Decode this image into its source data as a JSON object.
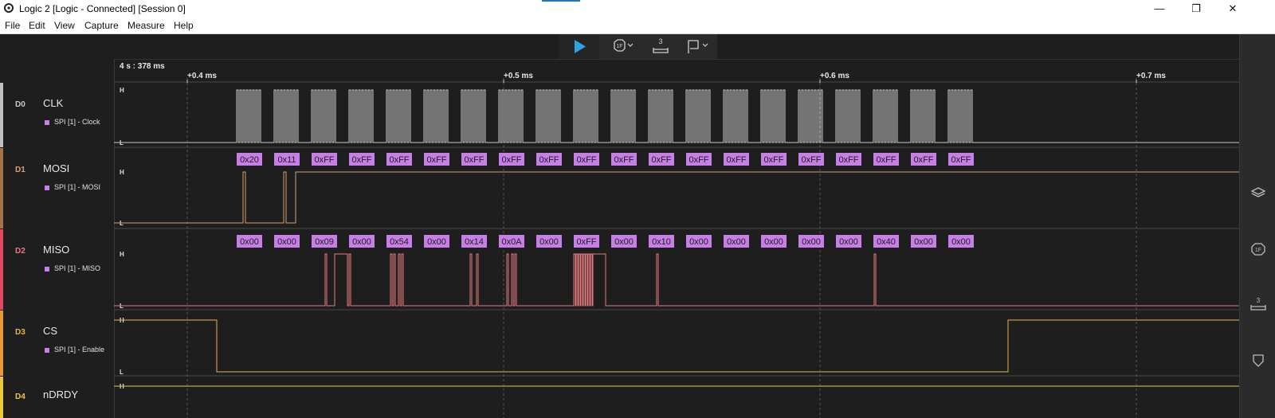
{
  "window": {
    "title": "Logic 2 [Logic - Connected] [Session 0]",
    "controls": {
      "minimize": "—",
      "maximize": "❐",
      "close": "✕"
    }
  },
  "menu": [
    "File",
    "Edit",
    "View",
    "Capture",
    "Measure",
    "Help"
  ],
  "toolbar": {
    "play_icon": "play-icon",
    "analyzers_icon": "analyzer-hex-icon",
    "measure_icon": "measure-icon",
    "marker_icon": "flag-icon",
    "measure_badge": "3"
  },
  "rightbar": {
    "icons": [
      "layers-icon",
      "analyzer-hex-icon",
      "measure-icon",
      "marker-icon"
    ],
    "analyzer_badge": "1F",
    "measure_badge": "3"
  },
  "timeline": {
    "origin": "4 s : 378 ms",
    "ticks": [
      {
        "label": "+0.4 ms",
        "value": 0.4
      },
      {
        "label": "+0.5 ms",
        "value": 0.5
      },
      {
        "label": "+0.6 ms",
        "value": 0.6
      },
      {
        "label": "+0.7 ms",
        "value": 0.7
      }
    ],
    "range_ms": [
      0.377,
      0.734
    ]
  },
  "colors": {
    "analyzer_label": "#c77ee6",
    "clk": "#cfcfcf",
    "mosi": "#d9a070",
    "miso": "#e87a80",
    "cs": "#e8b14a",
    "ndrdy": "#e8c843",
    "accent": "#2ea3df"
  },
  "channels": [
    {
      "index": "D0",
      "name": "CLK",
      "analyzer": "SPI [1] - Clock",
      "color": "#c9c9c9",
      "strip": "#c0c0c0",
      "high": "H",
      "low": "L"
    },
    {
      "index": "D1",
      "name": "MOSI",
      "analyzer": "SPI [1] - MOSI",
      "color": "#d9a070",
      "strip": "#a5734a",
      "high": "H",
      "low": "L"
    },
    {
      "index": "D2",
      "name": "MISO",
      "analyzer": "SPI [1] - MISO",
      "color": "#e87a80",
      "strip": "#e04b60",
      "high": "H",
      "low": "L"
    },
    {
      "index": "D3",
      "name": "CS",
      "analyzer": "SPI [1] - Enable",
      "color": "#e8b14a",
      "strip": "#e89a3a",
      "high": "H",
      "low": "L"
    },
    {
      "index": "D4",
      "name": "nDRDY",
      "analyzer": "",
      "color": "#e8c843",
      "strip": "#e8c843",
      "high": "H",
      "low": ""
    }
  ],
  "spi": {
    "mosi": [
      "0x20",
      "0x11",
      "0xFF",
      "0xFF",
      "0xFF",
      "0xFF",
      "0xFF",
      "0xFF",
      "0xFF",
      "0xFF",
      "0xFF",
      "0xFF",
      "0xFF",
      "0xFF",
      "0xFF",
      "0xFF",
      "0xFF",
      "0xFF",
      "0xFF",
      "0xFF"
    ],
    "miso": [
      "0x00",
      "0x00",
      "0x09",
      "0x00",
      "0x54",
      "0x00",
      "0x14",
      "0x0A",
      "0x00",
      "0xFF",
      "0x00",
      "0x10",
      "0x00",
      "0x00",
      "0x00",
      "0x00",
      "0x00",
      "0x40",
      "0x00",
      "0x00"
    ]
  }
}
